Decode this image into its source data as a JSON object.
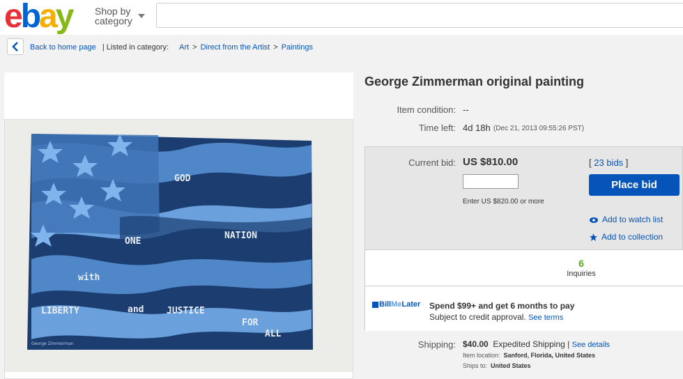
{
  "header": {
    "logo": {
      "e": "e",
      "b": "b",
      "a": "a",
      "y": "y"
    },
    "shop_by_line1": "Shop by",
    "shop_by_line2": "category",
    "search_placeholder": ""
  },
  "breadcrumb": {
    "back": "Back to home page",
    "listed": "| Listed in category:",
    "items": [
      "Art",
      "Direct from the Artist",
      "Paintings"
    ],
    "sep": ">"
  },
  "painting": {
    "words": {
      "god": "GOD",
      "one": "ONE",
      "nation": "NATION",
      "with": "with",
      "liberty": "LIBERTY",
      "and": "and",
      "justice": "JUSTICE",
      "for": "FOR",
      "all": "ALL"
    },
    "signature": "George Zimmerman"
  },
  "item": {
    "title": "George Zimmerman original painting",
    "condition_label": "Item condition:",
    "condition_value": "--",
    "time_label": "Time left:",
    "time_value": "4d 18h",
    "time_detail": "(Dec 21, 2013   09:55:26 PST)"
  },
  "bid": {
    "current_label": "Current bid:",
    "current_value": "US $810.00",
    "bids_open": "[",
    "bids_link": "23 bids",
    "bids_close": "]",
    "enter_hint": "Enter US $820.00 or more",
    "place_bid": "Place bid",
    "watch": "Add to watch list",
    "collection": "Add to collection",
    "inquiries_count": "6",
    "inquiries_label": "Inquiries"
  },
  "billmelater": {
    "brand_bill": "Bill",
    "brand_me": "Me",
    "brand_later": "Later",
    "headline": "Spend $99+ and get 6 months to pay",
    "subtext": "Subject to credit approval.",
    "see_terms": "See terms"
  },
  "shipping": {
    "label": "Shipping:",
    "cost": "$40.00",
    "method": "Expedited Shipping",
    "sep": "|",
    "details": "See details",
    "location_label": "Item location:",
    "location": "Sanford, Florida, United States",
    "ships_label": "Ships to:",
    "ships": "United States"
  }
}
